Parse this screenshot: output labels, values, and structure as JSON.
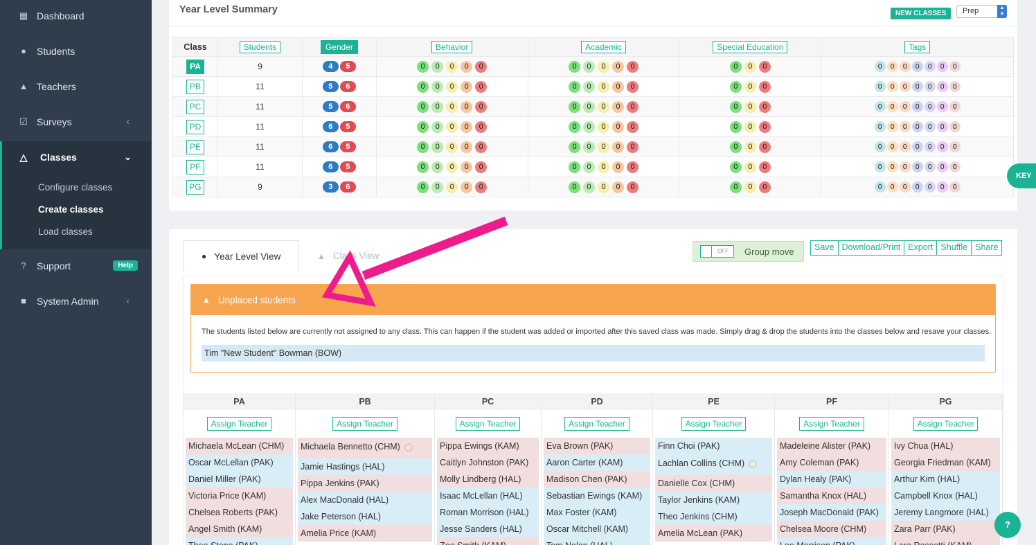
{
  "sidebar": {
    "items": [
      {
        "label": "Dashboard",
        "icon": "grid-icon",
        "top": 0
      },
      {
        "label": "Students",
        "icon": "user-icon"
      },
      {
        "label": "Teachers",
        "icon": "graduation-cap-icon"
      },
      {
        "label": "Surveys",
        "icon": "checkbox-icon"
      }
    ],
    "classes": {
      "label": "Classes",
      "sub": [
        "Configure classes",
        "Create classes",
        "Load classes"
      ]
    },
    "support": {
      "label": "Support",
      "badge": "Help"
    },
    "system_admin": {
      "label": "System Admin"
    }
  },
  "summary": {
    "title": "Year Level Summary",
    "new_classes": "NEW CLASSES",
    "year_select": "Prep",
    "headers": {
      "class": "Class",
      "students": "Students",
      "gender": "Gender",
      "behavior": "Behavior",
      "academic": "Academic",
      "special": "Special Education",
      "tags": "Tags"
    },
    "rows": [
      {
        "cls": "PA",
        "students": "9",
        "g1": "4",
        "g2": "5"
      },
      {
        "cls": "PB",
        "students": "11",
        "g1": "5",
        "g2": "6"
      },
      {
        "cls": "PC",
        "students": "11",
        "g1": "5",
        "g2": "6"
      },
      {
        "cls": "PD",
        "students": "11",
        "g1": "6",
        "g2": "5"
      },
      {
        "cls": "PE",
        "students": "11",
        "g1": "6",
        "g2": "5"
      },
      {
        "cls": "PF",
        "students": "11",
        "g1": "6",
        "g2": "5"
      },
      {
        "cls": "PG",
        "students": "9",
        "g1": "3",
        "g2": "6"
      }
    ],
    "zero": "0"
  },
  "key_tab": "KEY",
  "tabs": {
    "year_level_view": "Year Level View",
    "class_view": "Class View"
  },
  "group_move": {
    "label": "Group move",
    "toggle": "OFF"
  },
  "actions": [
    "Save",
    "Download/Print",
    "Export",
    "Shuffle",
    "Share"
  ],
  "unplaced": {
    "title": "Unplaced students",
    "text": "The students listed below are currently not assigned to any class. This can happen if the student was added or imported after this saved class was made. Simply drag & drop the students into the classes below and resave your classes.",
    "student": "Tim \"New Student\" Bowman (BOW)"
  },
  "assign_teacher": "Assign Teacher",
  "classes": [
    {
      "name": "PA",
      "students": [
        [
          "Michaela McLean (CHM)",
          "f"
        ],
        [
          "Oscar McLellan (PAK)",
          "m"
        ],
        [
          "Daniel Miller (PAK)",
          "m"
        ],
        [
          "Victoria Price (KAM)",
          "f"
        ],
        [
          "Chelsea Roberts (PAK)",
          "f"
        ],
        [
          "Angel Smith (KAM)",
          "f"
        ],
        [
          "Theo Stone (PAK)",
          "m"
        ]
      ]
    },
    {
      "name": "PB",
      "students": [
        [
          "Michaela Bennetto (CHM)",
          "f",
          "c"
        ],
        [
          "Jamie Hastings (HAL)",
          "m"
        ],
        [
          "Pippa Jenkins (PAK)",
          "f"
        ],
        [
          "Alex MacDonald (HAL)",
          "m"
        ],
        [
          "Jake Peterson (HAL)",
          "m"
        ],
        [
          "Amelia Price (KAM)",
          "f"
        ]
      ]
    },
    {
      "name": "PC",
      "students": [
        [
          "Pippa Ewings (KAM)",
          "f"
        ],
        [
          "Caitlyn Johnston (PAK)",
          "f"
        ],
        [
          "Molly Lindberg (HAL)",
          "f"
        ],
        [
          "Isaac McLellan (HAL)",
          "m"
        ],
        [
          "Roman Morrison (HAL)",
          "m"
        ],
        [
          "Jesse Sanders (HAL)",
          "m"
        ],
        [
          "Zoe Smith (KAM)",
          "f"
        ]
      ]
    },
    {
      "name": "PD",
      "students": [
        [
          "Eva Brown (PAK)",
          "f"
        ],
        [
          "Aaron Carter (KAM)",
          "m"
        ],
        [
          "Madison Chen (PAK)",
          "f"
        ],
        [
          "Sebastian Ewings (KAM)",
          "m"
        ],
        [
          "Max Foster (KAM)",
          "m"
        ],
        [
          "Oscar Mitchell (KAM)",
          "m"
        ],
        [
          "Tom Nolan (HAL)",
          "m"
        ]
      ]
    },
    {
      "name": "PE",
      "students": [
        [
          "Finn Choi (PAK)",
          "m"
        ],
        [
          "Lachlan Collins (CHM)",
          "m",
          "c"
        ],
        [
          "Danielle Cox (CHM)",
          "f"
        ],
        [
          "Taylor Jenkins (KAM)",
          "m"
        ],
        [
          "Theo Jenkins (CHM)",
          "m"
        ],
        [
          "Amelia McLean (PAK)",
          "f"
        ]
      ]
    },
    {
      "name": "PF",
      "students": [
        [
          "Madeleine Alister (PAK)",
          "f"
        ],
        [
          "Amy Coleman (PAK)",
          "f"
        ],
        [
          "Dylan Healy (PAK)",
          "m"
        ],
        [
          "Samantha Knox (HAL)",
          "f"
        ],
        [
          "Joseph MacDonald (PAK)",
          "m"
        ],
        [
          "Chelsea Moore (CHM)",
          "f"
        ],
        [
          "Leo Morrison (PAK)",
          "m"
        ]
      ]
    },
    {
      "name": "PG",
      "students": [
        [
          "Ivy Chua (HAL)",
          "f"
        ],
        [
          "Georgia Friedman (KAM)",
          "f"
        ],
        [
          "Arthur Kim (HAL)",
          "m"
        ],
        [
          "Campbell Knox (HAL)",
          "m"
        ],
        [
          "Jeremy Langmore (HAL)",
          "m"
        ],
        [
          "Zara Parr (PAK)",
          "f"
        ],
        [
          "Lara Rossetti (KAM)",
          "f"
        ]
      ]
    }
  ],
  "help_button": "?",
  "colors": {
    "accent": "#1ab394",
    "sidebar": "#2f3d4d",
    "warning": "#f7a54f",
    "arrow": "#ee1c8a"
  }
}
